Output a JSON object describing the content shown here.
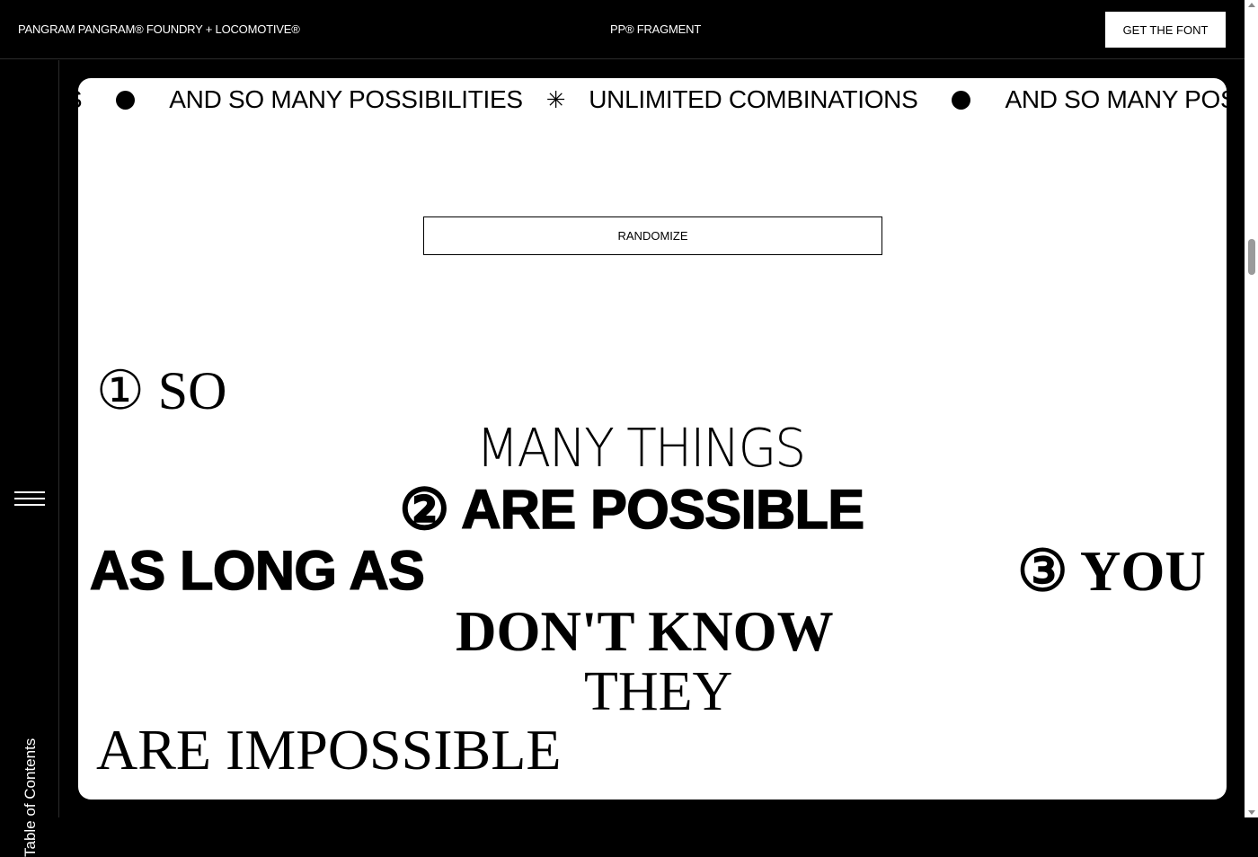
{
  "header": {
    "brand": "PANGRAM PANGRAM® FOUNDRY + LOCOMOTIVE®",
    "title": "PP® FRAGMENT",
    "cta_label": "GET THE FONT"
  },
  "sidebar": {
    "menu_icon": "hamburger-menu-icon",
    "toc_label": "Table of Contents"
  },
  "marquee": {
    "items": [
      "NS",
      "AND SO MANY POSSIBILITIES",
      "UNLIMITED COMBINATIONS",
      "AND SO MANY POSSIBILITIES"
    ],
    "dot_icon": "filled-circle-icon",
    "star_icon": "asterisk-star-icon",
    "star_glyph": "✳"
  },
  "randomize_label": "RANDOMIZE",
  "specimen": {
    "line1": "① SO",
    "line2": "MANY THINGS",
    "line3": "② ARE POSSIBLE",
    "line4": "AS LONG AS",
    "line5": "③ YOU",
    "line6": "DON'T KNOW",
    "line7": "THEY",
    "line8": "ARE IMPOSSIBLE"
  },
  "colors": {
    "background": "#000000",
    "panel": "#ffffff",
    "text_dark": "#000000",
    "text_light": "#ffffff"
  }
}
